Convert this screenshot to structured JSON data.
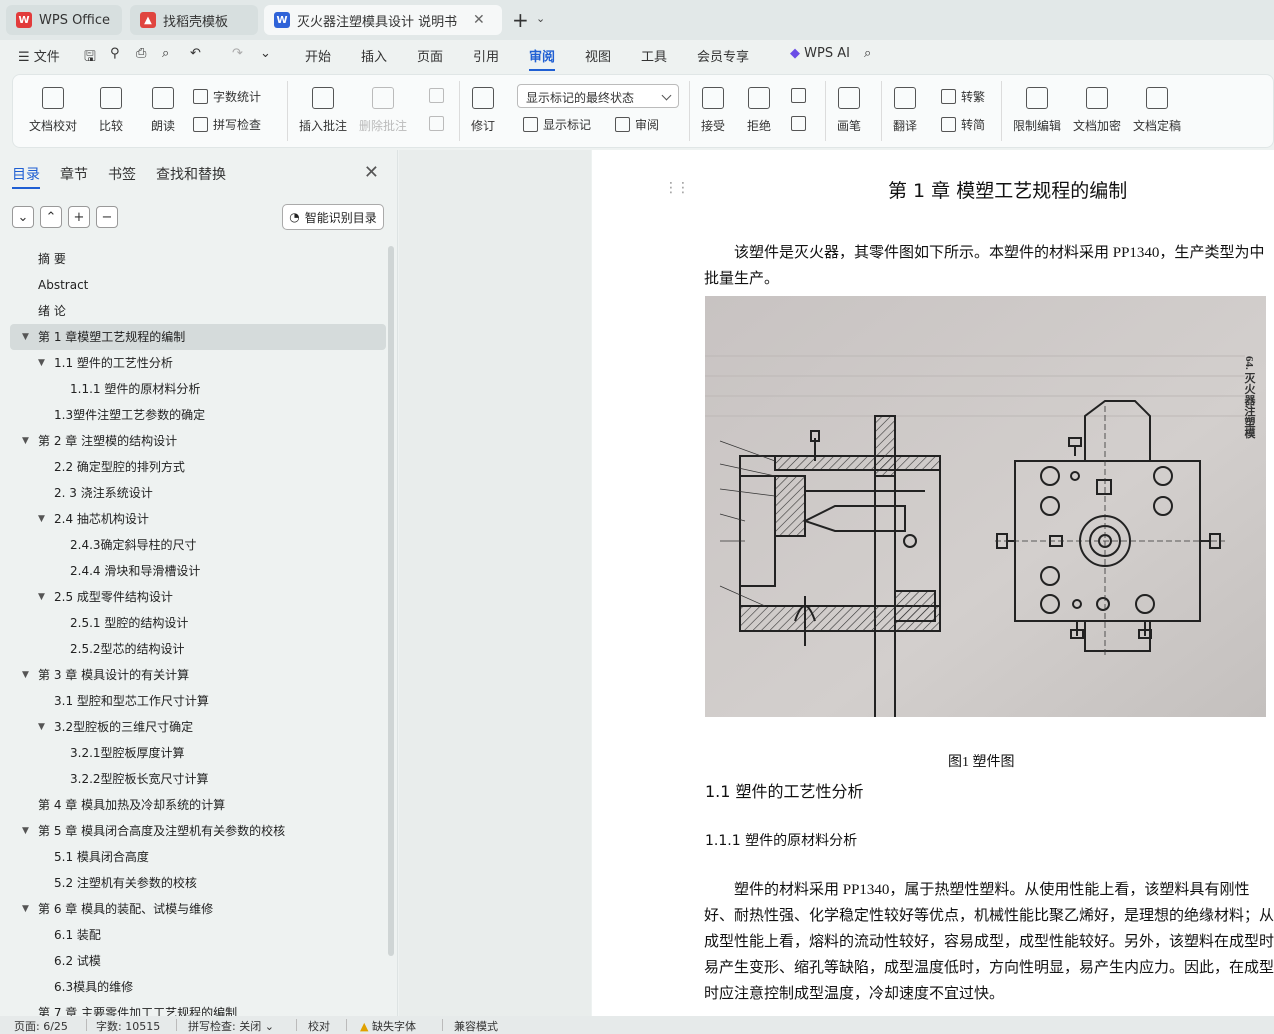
{
  "tabs": [
    {
      "label": "WPS Office"
    },
    {
      "label": "找稻壳模板"
    },
    {
      "label": "灭火器注塑模具设计 说明书（"
    }
  ],
  "menu": {
    "file": "文件",
    "items": [
      "开始",
      "插入",
      "页面",
      "引用",
      "审阅",
      "视图",
      "工具",
      "会员专享"
    ],
    "active": "审阅",
    "ai": "WPS AI"
  },
  "ribbon": {
    "doc_check": "文档校对",
    "compare": "比较",
    "read_aloud": "朗读",
    "word_count": "字数统计",
    "spell_check": "拼写检查",
    "insert_comment": "插入批注",
    "delete_comment": "删除批注",
    "revise": "修订",
    "markup_state": "显示标记的最终状态",
    "show_markup": "显示标记",
    "review": "审阅",
    "accept": "接受",
    "reject": "拒绝",
    "ink": "画笔",
    "translate": "翻译",
    "to_traditional": "转繁",
    "to_simplified": "转简",
    "restrict_edit": "限制编辑",
    "encrypt": "文档加密",
    "finalize": "文档定稿"
  },
  "nav": {
    "tabs": [
      "目录",
      "章节",
      "书签",
      "查找和替换"
    ],
    "smart_btn": "智能识别目录",
    "toc": [
      {
        "text": "摘  要",
        "level": 1,
        "arrow": false
      },
      {
        "text": "Abstract",
        "level": 1,
        "arrow": false
      },
      {
        "text": "绪 论",
        "level": 1,
        "arrow": false
      },
      {
        "text": "第 1 章模塑工艺规程的编制",
        "level": 1,
        "arrow": true,
        "selected": true
      },
      {
        "text": "1.1  塑件的工艺性分析",
        "level": 2,
        "arrow": true
      },
      {
        "text": "1.1.1    塑件的原材料分析",
        "level": 3,
        "arrow": false
      },
      {
        "text": "1.3塑件注塑工艺参数的确定",
        "level": 2,
        "arrow": false
      },
      {
        "text": "第 2 章  注塑模的结构设计",
        "level": 1,
        "arrow": true
      },
      {
        "text": "2.2  确定型腔的排列方式",
        "level": 2,
        "arrow": false
      },
      {
        "text": "2. 3  浇注系统设计",
        "level": 2,
        "arrow": false
      },
      {
        "text": "2.4  抽芯机构设计",
        "level": 2,
        "arrow": true
      },
      {
        "text": "2.4.3确定斜导柱的尺寸",
        "level": 3,
        "arrow": false
      },
      {
        "text": "2.4.4  滑块和导滑槽设计",
        "level": 3,
        "arrow": false
      },
      {
        "text": "2.5  成型零件结构设计",
        "level": 2,
        "arrow": true
      },
      {
        "text": "2.5.1  型腔的结构设计",
        "level": 3,
        "arrow": false
      },
      {
        "text": "2.5.2型芯的结构设计",
        "level": 3,
        "arrow": false
      },
      {
        "text": "第 3 章  模具设计的有关计算",
        "level": 1,
        "arrow": true
      },
      {
        "text": "3.1  型腔和型芯工作尺寸计算",
        "level": 2,
        "arrow": false
      },
      {
        "text": "3.2型腔板的三维尺寸确定",
        "level": 2,
        "arrow": true
      },
      {
        "text": "3.2.1型腔板厚度计算",
        "level": 3,
        "arrow": false
      },
      {
        "text": "3.2.2型腔板长宽尺寸计算",
        "level": 3,
        "arrow": false
      },
      {
        "text": "第 4 章  模具加热及冷却系统的计算",
        "level": 1,
        "arrow": false
      },
      {
        "text": "第 5 章  模具闭合高度及注塑机有关参数的校核",
        "level": 1,
        "arrow": true
      },
      {
        "text": "5.1  模具闭合高度",
        "level": 2,
        "arrow": false
      },
      {
        "text": "5.2  注塑机有关参数的校核",
        "level": 2,
        "arrow": false
      },
      {
        "text": "第 6 章  模具的装配、试模与维修",
        "level": 1,
        "arrow": true
      },
      {
        "text": "6.1  装配",
        "level": 2,
        "arrow": false
      },
      {
        "text": "6.2  试模",
        "level": 2,
        "arrow": false
      },
      {
        "text": "6.3模具的维修",
        "level": 2,
        "arrow": false
      },
      {
        "text": "第 7 章  主要零件加工工艺规程的编制",
        "level": 1,
        "arrow": false
      }
    ]
  },
  "document": {
    "chapter_title": "第 1 章  模塑工艺规程的编制",
    "intro_para": "该塑件是灭火器，其零件图如下所示。本塑件的材料采用 PP1340，生产类型为中批量生产。",
    "figure_label": "64. 灭火器注塑模",
    "figure_caption": "图1    塑件图",
    "section_title": "1.1  塑件的工艺性分析",
    "subsection_title": "1.1.1    塑件的原材料分析",
    "material_para": "塑件的材料采用 PP1340，属于热塑性塑料。从使用性能上看，该塑料具有刚性好、耐热性强、化学稳定性较好等优点，机械性能比聚乙烯好，是理想的绝缘材料；从成型性能上看，熔料的流动性较好，容易成型，成型性能较好。另外，该塑料在成型时易产生变形、缩孔等缺陷，成型温度低时，方向性明显，易产生内应力。因此，在成型时应注意控制成型温度，冷却速度不宜过快。"
  },
  "status": {
    "page": "页面: 6/25",
    "words": "字数: 10515",
    "spell": "拼写检查: 关闭",
    "proof": "校对",
    "missing_font": "缺失字体",
    "compat": "兼容模式"
  }
}
